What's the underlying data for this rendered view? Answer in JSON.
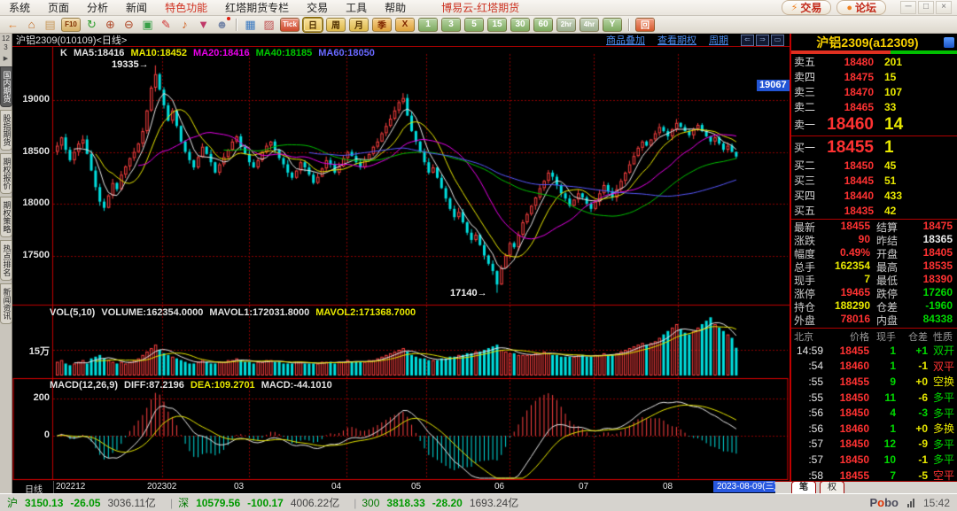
{
  "window": {
    "title": "博易云-红塔期货",
    "menu": [
      "系统",
      "页面",
      "分析",
      "新闻",
      "特色功能",
      "红塔期货专栏",
      "交易",
      "工具",
      "帮助"
    ],
    "menu_highlight": "特色功能",
    "trade_button": "交易",
    "forum_button": "论坛",
    "controls": [
      "─",
      "□",
      "×"
    ]
  },
  "toolbar": {
    "buttons": [
      {
        "name": "back-icon",
        "glyph": "←",
        "fg": "#e08030"
      },
      {
        "name": "home-icon",
        "glyph": "⌂",
        "fg": "#c06820"
      },
      {
        "name": "news-icon",
        "glyph": "▤",
        "fg": "#c89858"
      },
      {
        "name": "f10-icon",
        "text": "F10",
        "box": true,
        "small": true,
        "bg": "#e8c070",
        "fg": "#803000"
      },
      {
        "name": "refresh-icon",
        "glyph": "↻",
        "fg": "#30a030"
      },
      {
        "name": "zoom-in-icon",
        "glyph": "⊕",
        "fg": "#b04828"
      },
      {
        "name": "zoom-out-icon",
        "glyph": "⊖",
        "fg": "#b04828"
      },
      {
        "name": "overlay-icon",
        "glyph": "▣",
        "fg": "#38a048"
      },
      {
        "name": "draw-icon",
        "glyph": "✎",
        "fg": "#d03030"
      },
      {
        "name": "alert-icon",
        "glyph": "♪",
        "fg": "#d06020"
      },
      {
        "name": "filter-icon",
        "glyph": "▼",
        "fg": "#c03868"
      },
      {
        "name": "user-icon",
        "glyph": "☻",
        "fg": "#7888a8",
        "dot": true
      },
      {
        "sep": true
      },
      {
        "name": "quote-table-icon",
        "glyph": "▦",
        "fg": "#3878c0"
      },
      {
        "name": "trend-chart-icon",
        "glyph": "▨",
        "fg": "#c05050"
      },
      {
        "name": "tick-chart-button",
        "text": "Tick",
        "box": true,
        "small": true,
        "bg": "#e05030",
        "fg": "#ffffff"
      },
      {
        "name": "period-day-button",
        "text": "日",
        "box": true,
        "selected": true,
        "bg": "#f8d060",
        "fg": "#503000"
      },
      {
        "name": "period-week-button",
        "text": "周",
        "box": true,
        "bg": "#f0c850",
        "fg": "#503000"
      },
      {
        "name": "period-month-button",
        "text": "月",
        "box": true,
        "bg": "#f0c850",
        "fg": "#503000"
      },
      {
        "name": "period-quarter-button",
        "text": "季",
        "box": true,
        "bg": "#f0b040",
        "fg": "#802800"
      },
      {
        "name": "period-custom-button",
        "text": "X",
        "box": true,
        "bg": "#f0b040",
        "fg": "#802800"
      },
      {
        "name": "period-1min-button",
        "text": "1",
        "box": true,
        "bg": "#88b868",
        "fg": "#ffffff"
      },
      {
        "name": "period-3min-button",
        "text": "3",
        "box": true,
        "bg": "#88b868",
        "fg": "#ffffff"
      },
      {
        "name": "period-5min-button",
        "text": "5",
        "box": true,
        "bg": "#88b868",
        "fg": "#ffffff"
      },
      {
        "name": "period-15min-button",
        "text": "15",
        "box": true,
        "bg": "#88b868",
        "fg": "#ffffff"
      },
      {
        "name": "period-30min-button",
        "text": "30",
        "box": true,
        "bg": "#88b868",
        "fg": "#ffffff"
      },
      {
        "name": "period-60min-button",
        "text": "60",
        "box": true,
        "bg": "#88b868",
        "fg": "#ffffff"
      },
      {
        "name": "period-2hr-button",
        "text": "2hr",
        "box": true,
        "small": true,
        "bg": "#a8bc98",
        "fg": "#ffffff"
      },
      {
        "name": "period-4hr-button",
        "text": "4hr",
        "box": true,
        "small": true,
        "bg": "#a8bc98",
        "fg": "#ffffff"
      },
      {
        "name": "period-year-button",
        "text": "Y",
        "box": true,
        "bg": "#88b868",
        "fg": "#ffffff"
      },
      {
        "sep": true
      },
      {
        "name": "replay-button",
        "text": "回",
        "box": true,
        "bg": "#e86030",
        "fg": "#ffffff"
      }
    ]
  },
  "sidebar": {
    "pager_lines": [
      "12",
      "3"
    ],
    "arrow": "▶",
    "tabs": [
      {
        "label": "国内期货",
        "selected": true
      },
      {
        "label": "股指期货"
      },
      {
        "label": "期权报价"
      },
      {
        "label": "期权策略"
      },
      {
        "label": "热点排名"
      },
      {
        "label": "新闻资讯"
      }
    ]
  },
  "chart_header": {
    "instrument": "沪铝2309(010109)<日线>",
    "links": [
      "商品叠加",
      "查看期权",
      "周期"
    ],
    "mini_icons": [
      {
        "name": "prev-pane-icon",
        "glyph": "⇐"
      },
      {
        "name": "next-pane-icon",
        "glyph": "⇒"
      },
      {
        "name": "pane-layout-icon",
        "glyph": "▭"
      }
    ]
  },
  "kline_labels": {
    "k": "K",
    "mas": [
      {
        "text": "MA5:18416",
        "color": "#e0e0e0"
      },
      {
        "text": "MA10:18452",
        "color": "#e8e800"
      },
      {
        "text": "MA20:18416",
        "color": "#e800e8"
      },
      {
        "text": "MA40:18185",
        "color": "#00c800"
      },
      {
        "text": "MA60:18050",
        "color": "#6868ff"
      }
    ],
    "y_ticks": [
      "19000",
      "18500",
      "18000",
      "17500"
    ]
  },
  "vol_labels": {
    "items": [
      {
        "text": "VOL(5,10)",
        "color": "#e0e0e0"
      },
      {
        "text": "VOLUME:162354.0000",
        "color": "#e0e0e0"
      },
      {
        "text": "MAVOL1:172031.8000",
        "color": "#e0e0e0"
      },
      {
        "text": "MAVOL2:171368.7000",
        "color": "#e8e800"
      }
    ],
    "y_tick": "15万"
  },
  "macd_labels": {
    "items": [
      {
        "text": "MACD(12,26,9)",
        "color": "#e0e0e0"
      },
      {
        "text": "DIFF:87.2196",
        "color": "#e0e0e0"
      },
      {
        "text": "DEA:109.2701",
        "color": "#e8e800"
      },
      {
        "text": "MACD:-44.1010",
        "color": "#e0e0e0"
      }
    ],
    "y_ticks": [
      "200",
      "0"
    ]
  },
  "x_axis": {
    "period_label": "日线",
    "cursor_date": "2023-08-09(三)"
  },
  "quote_panel": {
    "title": "沪铝2309(a12309)",
    "ratio": {
      "red": 0.6,
      "green": 0.4
    },
    "asks": [
      {
        "label": "卖五",
        "price": "18480",
        "vol": "201"
      },
      {
        "label": "卖四",
        "price": "18475",
        "vol": "15"
      },
      {
        "label": "卖三",
        "price": "18470",
        "vol": "107"
      },
      {
        "label": "卖二",
        "price": "18465",
        "vol": "33"
      },
      {
        "label": "卖一",
        "price": "18460",
        "vol": "14",
        "big": true
      }
    ],
    "bids": [
      {
        "label": "买一",
        "price": "18455",
        "vol": "1",
        "big": true
      },
      {
        "label": "买二",
        "price": "18450",
        "vol": "45"
      },
      {
        "label": "买三",
        "price": "18445",
        "vol": "51"
      },
      {
        "label": "买四",
        "price": "18440",
        "vol": "433"
      },
      {
        "label": "买五",
        "price": "18435",
        "vol": "42"
      }
    ],
    "stats": [
      [
        {
          "label": "最新",
          "value": "18455",
          "c": "#ff3232"
        },
        {
          "label": "结算",
          "value": "18475",
          "c": "#ff3232"
        }
      ],
      [
        {
          "label": "涨跌",
          "value": "90",
          "c": "#ff3232"
        },
        {
          "label": "昨结",
          "value": "18365",
          "c": "#e8e8e8"
        }
      ],
      [
        {
          "label": "幅度",
          "value": "0.49%",
          "c": "#ff3232"
        },
        {
          "label": "开盘",
          "value": "18405",
          "c": "#ff3232"
        }
      ],
      [
        {
          "label": "总手",
          "value": "162354",
          "c": "#e8e800"
        },
        {
          "label": "最高",
          "value": "18535",
          "c": "#ff3232"
        }
      ],
      [
        {
          "label": "现手",
          "value": "7",
          "c": "#e8e800"
        },
        {
          "label": "最低",
          "value": "18390",
          "c": "#ff3232"
        }
      ],
      [
        {
          "label": "涨停",
          "value": "19465",
          "c": "#ff3232"
        },
        {
          "label": "跌停",
          "value": "17260",
          "c": "#00d800"
        }
      ],
      [
        {
          "label": "持仓",
          "value": "188290",
          "c": "#e8e800"
        },
        {
          "label": "仓差",
          "value": "-1960",
          "c": "#00d800"
        }
      ],
      [
        {
          "label": "外盘",
          "value": "78016",
          "c": "#ff3232"
        },
        {
          "label": "内盘",
          "value": "84338",
          "c": "#00d800"
        }
      ]
    ],
    "tick_headers": [
      "北京",
      "价格",
      "现手",
      "仓差",
      "性质"
    ],
    "tick_rows": [
      {
        "time": "14:59",
        "price": "18455",
        "vol": "1",
        "oi": "+1",
        "oc": "#00d800",
        "nature": "双开",
        "nc": "#00d800"
      },
      {
        "time": ":54",
        "price": "18460",
        "vol": "1",
        "oi": "-1",
        "oc": "#e8e800",
        "nature": "双平",
        "nc": "#ff3232"
      },
      {
        "time": ":55",
        "price": "18455",
        "vol": "9",
        "oi": "+0",
        "oc": "#e8e800",
        "nature": "空换",
        "nc": "#e8e800"
      },
      {
        "time": ":55",
        "price": "18450",
        "vol": "11",
        "oi": "-6",
        "oc": "#e8e800",
        "nature": "多平",
        "nc": "#00d800"
      },
      {
        "time": ":56",
        "price": "18450",
        "vol": "4",
        "oi": "-3",
        "oc": "#00d800",
        "nature": "多平",
        "nc": "#00d800"
      },
      {
        "time": ":56",
        "price": "18460",
        "vol": "1",
        "oi": "+0",
        "oc": "#e8e800",
        "nature": "多换",
        "nc": "#e8e800"
      },
      {
        "time": ":57",
        "price": "18450",
        "vol": "12",
        "oi": "-9",
        "oc": "#e8e800",
        "nature": "多平",
        "nc": "#00d800"
      },
      {
        "time": ":57",
        "price": "18450",
        "vol": "10",
        "oi": "-1",
        "oc": "#e8e800",
        "nature": "多平",
        "nc": "#00d800"
      },
      {
        "time": ":58",
        "price": "18455",
        "vol": "7",
        "oi": "-5",
        "oc": "#e8e800",
        "nature": "空平",
        "nc": "#ff3232"
      }
    ],
    "tabs": {
      "left": "笔",
      "right": "权"
    }
  },
  "statusbar": {
    "indices": [
      {
        "name": "沪",
        "value": "3150.13",
        "change": "-26.05",
        "turnover": "3036.11亿"
      },
      {
        "name": "深",
        "value": "10579.56",
        "change": "-100.17",
        "turnover": "4006.22亿"
      },
      {
        "name": "300",
        "value": "3818.33",
        "change": "-28.20",
        "turnover": "1693.24亿"
      }
    ],
    "brand": "Pobo",
    "time": "15:42"
  },
  "chart_data": {
    "type": "candlestick",
    "symbol": "沪铝2309",
    "period": "日线",
    "price_gridlines": [
      19000,
      18500,
      18000,
      17500
    ],
    "volume_gridline": 150000,
    "macd_gridlines": [
      200,
      0
    ],
    "high_annotation": "19335→",
    "low_annotation": "17140→",
    "right_price_tag": "19067",
    "high_value": 19335,
    "april_high_value": 19067,
    "low_value": 17140,
    "last_close": 18455,
    "last_volume": 162354,
    "peak_index": 23,
    "april_high_index": 81,
    "low_index": 103,
    "ma_periods": [
      5,
      10,
      20,
      40,
      60
    ],
    "vol_ma_periods": [
      5,
      10
    ],
    "macd_params": [
      12,
      26,
      9
    ],
    "x_ticks": [
      {
        "label": "202212",
        "x": 63
      },
      {
        "label": "202302",
        "x": 183
      },
      {
        "label": "03",
        "x": 281
      },
      {
        "label": "04",
        "x": 391
      },
      {
        "label": "05",
        "x": 481
      },
      {
        "label": "06",
        "x": 575
      },
      {
        "label": "07",
        "x": 670
      },
      {
        "label": "08",
        "x": 765
      }
    ],
    "closes": [
      18560,
      18640,
      18520,
      18420,
      18500,
      18580,
      18620,
      18480,
      18320,
      18160,
      18020,
      17960,
      18080,
      18200,
      18140,
      18280,
      18360,
      18440,
      18500,
      18580,
      18700,
      18900,
      19120,
      19250,
      19100,
      18950,
      18800,
      18900,
      18750,
      18600,
      18500,
      18420,
      18350,
      18450,
      18550,
      18480,
      18400,
      18300,
      18380,
      18450,
      18520,
      18600,
      18650,
      18550,
      18480,
      18400,
      18350,
      18420,
      18500,
      18560,
      18600,
      18520,
      18440,
      18380,
      18300,
      18250,
      18320,
      18400,
      18350,
      18280,
      18200,
      18260,
      18340,
      18420,
      18380,
      18300,
      18360,
      18440,
      18500,
      18460,
      18400,
      18350,
      18420,
      18480,
      18550,
      18600,
      18680,
      18750,
      18820,
      18900,
      18980,
      19020,
      18850,
      18700,
      18600,
      18500,
      18400,
      18300,
      18350,
      18250,
      18150,
      18050,
      17950,
      17870,
      17920,
      17820,
      17720,
      17650,
      17700,
      17600,
      17500,
      17420,
      17350,
      17220,
      17380,
      17500,
      17620,
      17580,
      17700,
      17820,
      17900,
      17980,
      18060,
      18150,
      18220,
      18300,
      18260,
      18180,
      18100,
      18050,
      17980,
      18040,
      18100,
      18060,
      18000,
      17950,
      18020,
      18100,
      18180,
      18120,
      18060,
      18140,
      18220,
      18300,
      18380,
      18460,
      18540,
      18600,
      18560,
      18620,
      18680,
      18740,
      18700,
      18650,
      18720,
      18780,
      18740,
      18700,
      18660,
      18720,
      18760,
      18700,
      18650,
      18600,
      18640,
      18580,
      18520,
      18560,
      18500,
      18455
    ],
    "volumes_wan": [
      8,
      9,
      7,
      6,
      7,
      8,
      9,
      7,
      10,
      11,
      12,
      10,
      9,
      8,
      7,
      8,
      7,
      8,
      9,
      10,
      12,
      14,
      16,
      18,
      15,
      13,
      12,
      11,
      10,
      9,
      8,
      7,
      7,
      8,
      9,
      8,
      7,
      7,
      8,
      8,
      9,
      9,
      10,
      9,
      8,
      8,
      7,
      8,
      8,
      9,
      9,
      8,
      8,
      7,
      7,
      7,
      8,
      8,
      7,
      7,
      7,
      7,
      8,
      8,
      8,
      7,
      8,
      8,
      9,
      8,
      8,
      8,
      8,
      9,
      9,
      10,
      11,
      12,
      13,
      14,
      15,
      16,
      14,
      12,
      11,
      10,
      10,
      9,
      9,
      9,
      10,
      10,
      11,
      11,
      12,
      12,
      13,
      13,
      14,
      14,
      15,
      16,
      17,
      18,
      15,
      14,
      13,
      13,
      12,
      12,
      12,
      12,
      13,
      13,
      14,
      13,
      12,
      12,
      11,
      11,
      11,
      11,
      12,
      12,
      11,
      11,
      12,
      12,
      13,
      12,
      12,
      13,
      14,
      15,
      16,
      17,
      18,
      19,
      18,
      19,
      20,
      22,
      24,
      26,
      28,
      30,
      27,
      25,
      24,
      26,
      28,
      30,
      32,
      34,
      30,
      28,
      26,
      24,
      22,
      16.2
    ]
  }
}
